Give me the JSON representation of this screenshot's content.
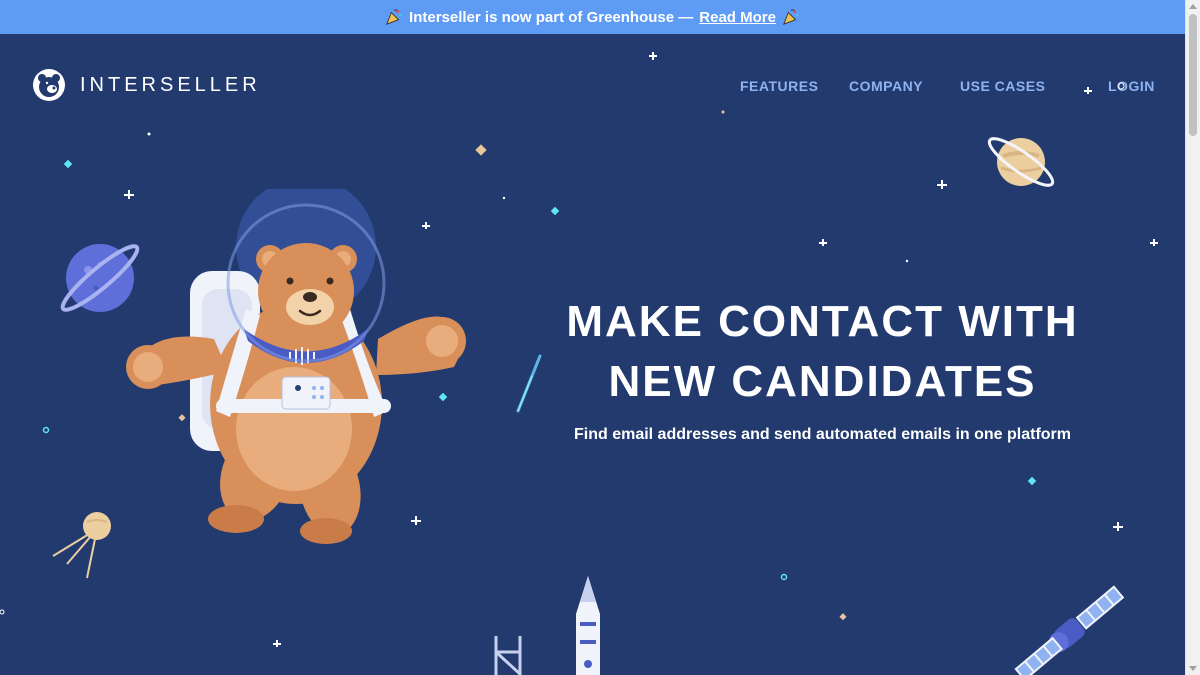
{
  "banner": {
    "text": "Interseller is now part of Greenhouse —",
    "link_label": "Read More",
    "color": "#5e9bf5"
  },
  "brand": {
    "name": "INTERSELLER",
    "logo_icon": "bear-logo-icon"
  },
  "nav": {
    "items": [
      {
        "label": "FEATURES"
      },
      {
        "label": "COMPANY"
      },
      {
        "label": "USE CASES"
      },
      {
        "label": "LOGIN"
      }
    ]
  },
  "hero": {
    "headline_line1": "MAKE CONTACT WITH",
    "headline_line2": "NEW CANDIDATES",
    "subheadline": "Find email addresses and send automated emails in one platform"
  },
  "colors": {
    "background": "#223a6e",
    "nav_link": "#8fb2f0",
    "accent_teal": "#5ee6f0",
    "bear": "#d98f5a"
  },
  "illustrations": [
    "astronaut-bear-icon",
    "blue-planet-icon",
    "ringed-planet-icon",
    "sputnik-icon",
    "rocket-icon",
    "satellite-icon",
    "comet-icon",
    "star-icon"
  ]
}
